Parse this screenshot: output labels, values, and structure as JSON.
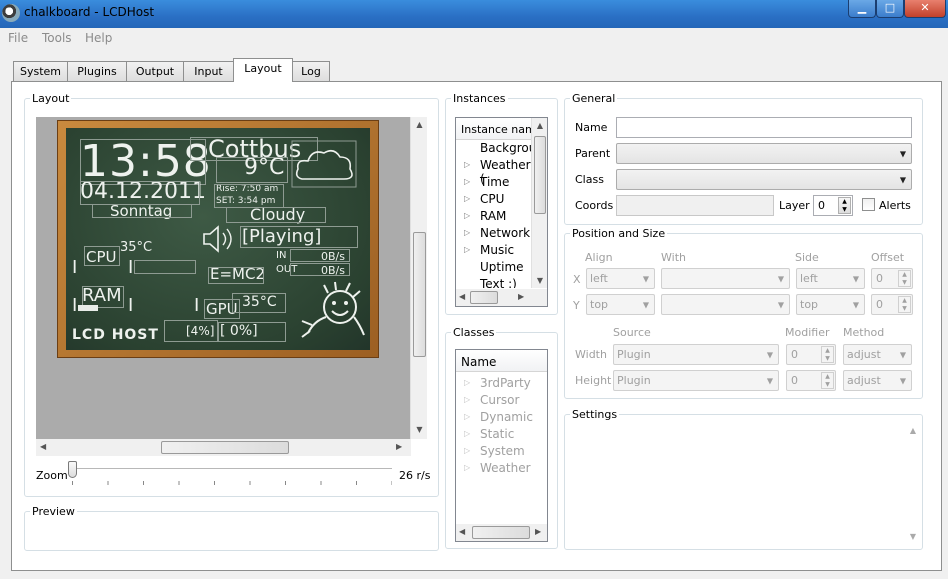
{
  "window": {
    "title": "chalkboard - LCDHost",
    "minimize": "▁",
    "maximize": "□",
    "close": "✕"
  },
  "menu": {
    "items": [
      "File",
      "Tools",
      "Help"
    ]
  },
  "tabs": {
    "items": [
      "System",
      "Plugins",
      "Output",
      "Input",
      "Layout",
      "Log"
    ],
    "active": "Layout"
  },
  "layout_group": {
    "title": "Layout",
    "zoom_label": "Zoom",
    "zoom_value": "26 r/s",
    "zoom_level": 0.0
  },
  "preview_group": {
    "title": "Preview"
  },
  "lcd": {
    "time": "13:58",
    "date": "04.12.2011",
    "day": "Sonntag",
    "city": "Cottbus",
    "temp": "9°C",
    "rise": "Rise: 7:50 am",
    "set": "SET: 3:54 pm",
    "weather": "Cloudy",
    "music": "[Playing]",
    "net_in_label": "IN",
    "net_out_label": "OUT",
    "net_in": "0B/s",
    "net_out": "0B/s",
    "cpu": "CPU",
    "cpu_temp": "35°C",
    "emc2": "E=MC2",
    "ram": "RAM",
    "gpu": "GPU",
    "gpu_temp": "35°C",
    "brand": "LCD HOST",
    "ram_pct": "[4%]",
    "gpu_pct": "[ 0%]"
  },
  "instances": {
    "title": "Instances",
    "header": "Instance nam",
    "items": [
      {
        "label": "Backgrou",
        "caret": false
      },
      {
        "label": "Weather (",
        "caret": true
      },
      {
        "label": "Time",
        "caret": true
      },
      {
        "label": "CPU",
        "caret": true
      },
      {
        "label": "RAM",
        "caret": true
      },
      {
        "label": "Network",
        "caret": true
      },
      {
        "label": "Music",
        "caret": true
      },
      {
        "label": "Uptime",
        "caret": false
      },
      {
        "label": "Text :)",
        "caret": false
      }
    ]
  },
  "classes": {
    "title": "Classes",
    "header": "Name",
    "items": [
      "3rdParty",
      "Cursor",
      "Dynamic",
      "Static",
      "System",
      "Weather"
    ]
  },
  "general": {
    "title": "General",
    "name_label": "Name",
    "name_value": "",
    "parent_label": "Parent",
    "class_label": "Class",
    "coords_label": "Coords",
    "layer_label": "Layer",
    "layer_value": "0",
    "alerts_label": "Alerts"
  },
  "position": {
    "title": "Position and Size",
    "align": "Align",
    "with": "With",
    "side": "Side",
    "offset": "Offset",
    "x": "X",
    "y": "Y",
    "x_align": "left",
    "y_align": "top",
    "x_side": "left",
    "y_side": "top",
    "x_offset": "0",
    "y_offset": "0",
    "source": "Source",
    "modifier": "Modifier",
    "method": "Method",
    "width_label": "Width",
    "height_label": "Height",
    "width_source": "Plugin",
    "height_source": "Plugin",
    "width_mod": "0",
    "height_mod": "0",
    "width_method": "adjust",
    "height_method": "adjust"
  },
  "settings": {
    "title": "Settings"
  },
  "colors": {
    "titlebar": "#2a6fc4",
    "chalkboard": "#2f4a35",
    "frame": "#b8772f"
  }
}
